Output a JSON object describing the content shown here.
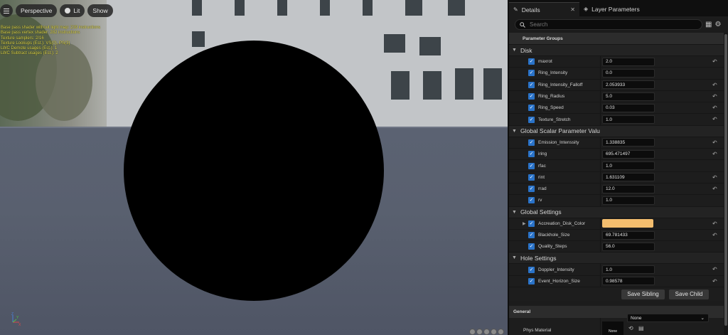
{
  "viewport": {
    "toolbar": {
      "perspective": "Perspective",
      "lit": "Lit",
      "show": "Show"
    },
    "stats": [
      "Base pass shader without light map: 239 instructions",
      "Base pass vertex shader: 282 instructions",
      "Texture samplers: 2/16",
      "Texture Lookups (Est.): VS(0), PS(3)",
      "LWC Demote usages (Est.): 1",
      "LWC Subtract usages (Est.): 2"
    ],
    "axis_labels": {
      "z": "Z",
      "x": "X",
      "y": "Y"
    }
  },
  "panel": {
    "tabs": [
      {
        "label": "Details",
        "close": "✕"
      },
      {
        "label": "Layer Parameters"
      }
    ],
    "search_placeholder": "Search",
    "parameter_groups_label": "Parameter Groups",
    "groups": {
      "disk": {
        "title": "Disk",
        "params": [
          {
            "name": "maxrot",
            "value": "2.0"
          },
          {
            "name": "Ring_Intensity",
            "value": "0.0"
          },
          {
            "name": "Ring_Intensity_Falloff",
            "value": "2.053933"
          },
          {
            "name": "Ring_Radius",
            "value": "5.0"
          },
          {
            "name": "Ring_Speed",
            "value": "0.03"
          },
          {
            "name": "Texture_Stretch",
            "value": "1.0"
          }
        ]
      },
      "global_scalar": {
        "title": "Global Scalar Parameter Valu",
        "params": [
          {
            "name": "Emission_Intenssity",
            "value": "1.338835"
          },
          {
            "name": "iring",
            "value": "695.471497"
          },
          {
            "name": "rfac",
            "value": "1.0"
          },
          {
            "name": "rint",
            "value": "1.631109"
          },
          {
            "name": "rrad",
            "value": "12.0"
          },
          {
            "name": "rv",
            "value": "1.0"
          }
        ]
      },
      "global_settings": {
        "title": "Global Settings",
        "params": [
          {
            "name": "Accreation_Disk_Color",
            "value": ""
          },
          {
            "name": "Blackhole_Size",
            "value": "69.781433"
          },
          {
            "name": "Quality_Steps",
            "value": "56.0"
          }
        ]
      },
      "hole_settings": {
        "title": "Hole Settings",
        "params": [
          {
            "name": "Doppler_Intensity",
            "value": "1.0"
          },
          {
            "name": "Event_Horizon_Size",
            "value": "0.98578"
          }
        ]
      }
    },
    "buttons": {
      "save_sibling": "Save Sibling",
      "save_child": "Save Child"
    },
    "general": {
      "title": "General",
      "phys_material_label": "Phys Material",
      "phys_material_thumb": "None",
      "phys_material_value": "None"
    }
  },
  "colors": {
    "accretion_disk_color": "#f3bd6e",
    "checkbox": "#2a73c9",
    "stats_text": "#e0d84a"
  }
}
